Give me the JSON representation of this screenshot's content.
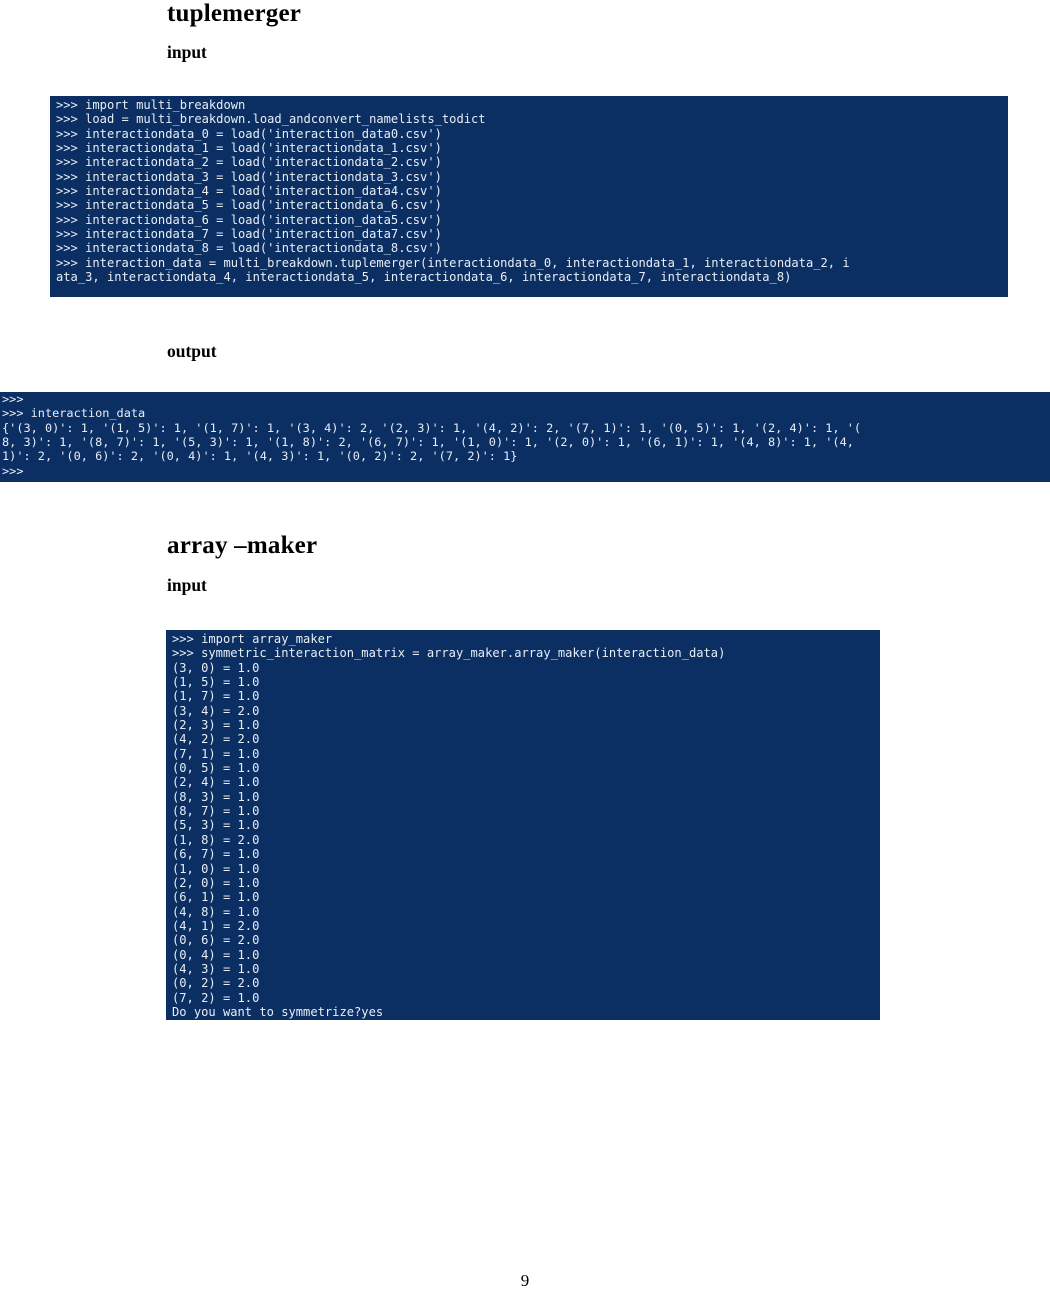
{
  "page": {
    "number": "9"
  },
  "sections": [
    {
      "id": "tuplemerger",
      "title": "tuplemerger",
      "input_label": "input",
      "output_label": "output"
    },
    {
      "id": "array_maker",
      "title": "array –maker",
      "input_label": "input"
    }
  ],
  "terminals": {
    "tuplemerger_input": {
      "name": "python-console",
      "prompt": ">>>",
      "background": "#0b2e63",
      "foreground": "#e9eef5",
      "lines": [
        ">>> import multi_breakdown",
        ">>> load = multi_breakdown.load_andconvert_namelists_todict",
        ">>> interactiondata_0 = load('interaction_data0.csv')",
        ">>> interactiondata_1 = load('interactiondata_1.csv')",
        ">>> interactiondata_2 = load('interactiondata_2.csv')",
        ">>> interactiondata_3 = load('interactiondata_3.csv')",
        ">>> interactiondata_4 = load('interaction_data4.csv')",
        ">>> interactiondata_5 = load('interactiondata_6.csv')",
        ">>> interactiondata_6 = load('interaction_data5.csv')",
        ">>> interactiondata_7 = load('interaction_data7.csv')",
        ">>> interactiondata_8 = load('interactiondata_8.csv')",
        ">>> interaction_data = multi_breakdown.tuplemerger(interactiondata_0, interactiondata_1, interactiondata_2, i",
        "ata_3, interactiondata_4, interactiondata_5, interactiondata_6, interactiondata_7, interactiondata_8)"
      ]
    },
    "tuplemerger_output": {
      "name": "python-console",
      "prompt": ">>>",
      "background": "#0b2e63",
      "foreground": "#e9eef5",
      "lines": [
        ">>>",
        ">>> interaction_data",
        "{'(3, 0)': 1, '(1, 5)': 1, '(1, 7)': 1, '(3, 4)': 2, '(2, 3)': 1, '(4, 2)': 2, '(7, 1)': 1, '(0, 5)': 1, '(2, 4)': 1, '(",
        "8, 3)': 1, '(8, 7)': 1, '(5, 3)': 1, '(1, 8)': 2, '(6, 7)': 1, '(1, 0)': 1, '(2, 0)': 1, '(6, 1)': 1, '(4, 8)': 1, '(4,",
        "1)': 2, '(0, 6)': 2, '(0, 4)': 1, '(4, 3)': 1, '(0, 2)': 2, '(7, 2)': 1}",
        ">>>"
      ]
    },
    "arraymaker_input": {
      "name": "python-console",
      "prompt": ">>>",
      "background": "#0b2e63",
      "foreground": "#e9eef5",
      "lines": [
        ">>> import array_maker",
        ">>> symmetric_interaction_matrix = array_maker.array_maker(interaction_data)",
        "(3, 0) = 1.0",
        "(1, 5) = 1.0",
        "(1, 7) = 1.0",
        "(3, 4) = 2.0",
        "(2, 3) = 1.0",
        "(4, 2) = 2.0",
        "(7, 1) = 1.0",
        "(0, 5) = 1.0",
        "(2, 4) = 1.0",
        "(8, 3) = 1.0",
        "(8, 7) = 1.0",
        "(5, 3) = 1.0",
        "(1, 8) = 2.0",
        "(6, 7) = 1.0",
        "(1, 0) = 1.0",
        "(2, 0) = 1.0",
        "(6, 1) = 1.0",
        "(4, 8) = 1.0",
        "(4, 1) = 2.0",
        "(0, 6) = 2.0",
        "(0, 4) = 1.0",
        "(4, 3) = 1.0",
        "(0, 2) = 2.0",
        "(7, 2) = 1.0",
        "Do you want to symmetrize?yes"
      ]
    }
  }
}
